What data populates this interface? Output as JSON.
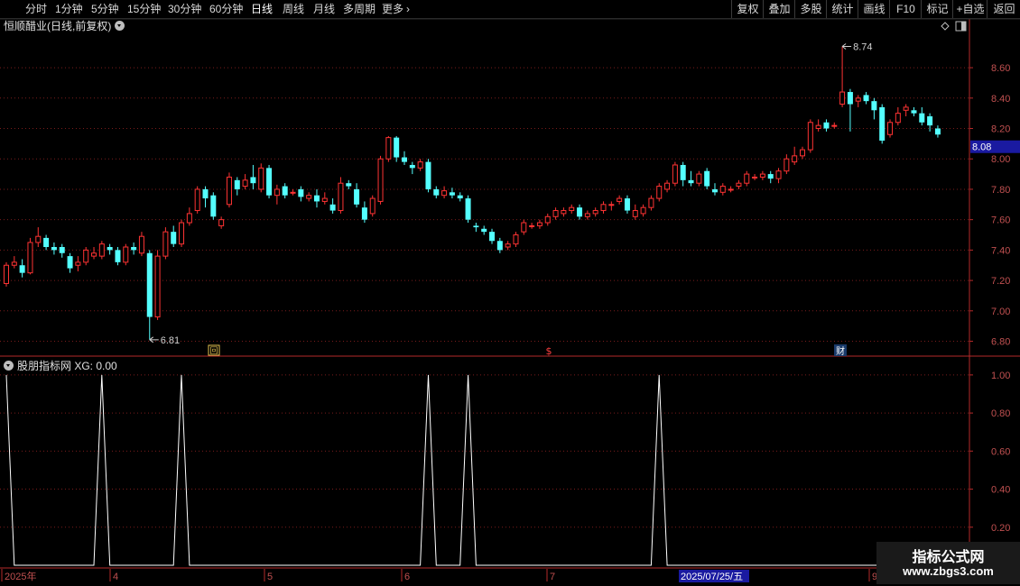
{
  "toolbar": {
    "periods": [
      "分时",
      "1分钟",
      "5分钟",
      "15分钟",
      "30分钟",
      "60分钟",
      "日线",
      "周线",
      "月线",
      "多周期",
      "更多"
    ],
    "active_period": "日线",
    "right_buttons": [
      "复权",
      "叠加",
      "多股",
      "统计",
      "画线",
      "F10",
      "标记",
      "+自选",
      "返回"
    ]
  },
  "chart_title": "恒顺醋业(日线,前复权)",
  "indicator_title": "股朋指标网 XG: 0.00",
  "price_axis": {
    "ticks": [
      "8.60",
      "8.40",
      "8.20",
      "8.00",
      "7.80",
      "7.60",
      "7.40",
      "7.20",
      "7.00",
      "6.80"
    ],
    "current_price": "8.08",
    "current_color": "#1a1aa0"
  },
  "indicator_axis": {
    "ticks": [
      "1.00",
      "0.80",
      "0.60",
      "0.40",
      "0.20"
    ]
  },
  "annotations": {
    "high": "8.74",
    "low": "6.81"
  },
  "event_markers": [
    {
      "label": "回"
    },
    {
      "label": "$"
    },
    {
      "label": "财"
    }
  ],
  "date_axis": {
    "labels": [
      "2025年",
      "4",
      "5",
      "6",
      "7",
      "9"
    ],
    "cursor_date": "2025/07/25/五"
  },
  "colors": {
    "up": "#ff3333",
    "down": "#54ffff",
    "grid": "#7a1c1c",
    "indicator_line": "#ffffff"
  },
  "watermark": {
    "line1": "指标公式网",
    "line2": "www.zbgs3.com"
  },
  "chart_data": {
    "type": "candlestick",
    "ylim": [
      6.72,
      8.82
    ],
    "candles": [
      [
        7.18,
        7.3,
        7.32,
        7.16
      ],
      [
        7.3,
        7.32,
        7.36,
        7.28
      ],
      [
        7.3,
        7.25,
        7.34,
        7.22
      ],
      [
        7.25,
        7.45,
        7.48,
        7.24
      ],
      [
        7.45,
        7.49,
        7.55,
        7.42
      ],
      [
        7.48,
        7.42,
        7.5,
        7.4
      ],
      [
        7.42,
        7.4,
        7.45,
        7.37
      ],
      [
        7.42,
        7.38,
        7.44,
        7.35
      ],
      [
        7.36,
        7.28,
        7.38,
        7.25
      ],
      [
        7.3,
        7.32,
        7.36,
        7.26
      ],
      [
        7.32,
        7.4,
        7.42,
        7.3
      ],
      [
        7.36,
        7.38,
        7.42,
        7.34
      ],
      [
        7.36,
        7.44,
        7.46,
        7.34
      ],
      [
        7.42,
        7.4,
        7.44,
        7.37
      ],
      [
        7.4,
        7.32,
        7.42,
        7.3
      ],
      [
        7.32,
        7.42,
        7.44,
        7.3
      ],
      [
        7.42,
        7.4,
        7.45,
        7.37
      ],
      [
        7.38,
        7.49,
        7.52,
        7.36
      ],
      [
        7.38,
        6.96,
        7.4,
        6.81
      ],
      [
        6.96,
        7.36,
        7.4,
        6.94
      ],
      [
        7.36,
        7.52,
        7.55,
        7.34
      ],
      [
        7.52,
        7.44,
        7.56,
        7.42
      ],
      [
        7.44,
        7.58,
        7.6,
        7.42
      ],
      [
        7.58,
        7.64,
        7.68,
        7.56
      ],
      [
        7.66,
        7.8,
        7.82,
        7.64
      ],
      [
        7.8,
        7.74,
        7.82,
        7.68
      ],
      [
        7.76,
        7.62,
        7.78,
        7.6
      ],
      [
        7.56,
        7.6,
        7.62,
        7.54
      ],
      [
        7.7,
        7.88,
        7.91,
        7.68
      ],
      [
        7.86,
        7.8,
        7.88,
        7.76
      ],
      [
        7.82,
        7.86,
        7.9,
        7.8
      ],
      [
        7.88,
        7.84,
        7.96,
        7.8
      ],
      [
        7.8,
        7.94,
        7.97,
        7.78
      ],
      [
        7.94,
        7.76,
        7.96,
        7.74
      ],
      [
        7.76,
        7.8,
        7.83,
        7.7
      ],
      [
        7.82,
        7.76,
        7.84,
        7.74
      ],
      [
        7.78,
        7.78,
        7.8,
        7.76
      ],
      [
        7.8,
        7.75,
        7.82,
        7.72
      ],
      [
        7.74,
        7.76,
        7.78,
        7.72
      ],
      [
        7.76,
        7.72,
        7.8,
        7.68
      ],
      [
        7.72,
        7.74,
        7.78,
        7.7
      ],
      [
        7.7,
        7.66,
        7.74,
        7.64
      ],
      [
        7.66,
        7.84,
        7.88,
        7.64
      ],
      [
        7.84,
        7.82,
        7.86,
        7.8
      ],
      [
        7.8,
        7.7,
        7.84,
        7.68
      ],
      [
        7.68,
        7.6,
        7.72,
        7.58
      ],
      [
        7.64,
        7.74,
        7.76,
        7.62
      ],
      [
        7.72,
        8.0,
        8.02,
        7.7
      ],
      [
        8.0,
        8.14,
        8.15,
        7.98
      ],
      [
        8.14,
        8.01,
        8.15,
        7.98
      ],
      [
        8.01,
        7.98,
        8.05,
        7.96
      ],
      [
        7.96,
        7.94,
        7.98,
        7.9
      ],
      [
        7.94,
        7.98,
        8.0,
        7.92
      ],
      [
        7.98,
        7.8,
        8.0,
        7.78
      ],
      [
        7.8,
        7.76,
        7.82,
        7.74
      ],
      [
        7.76,
        7.79,
        7.82,
        7.74
      ],
      [
        7.78,
        7.76,
        7.81,
        7.74
      ],
      [
        7.76,
        7.74,
        7.78,
        7.72
      ],
      [
        7.74,
        7.6,
        7.76,
        7.58
      ],
      [
        7.56,
        7.55,
        7.58,
        7.52
      ],
      [
        7.54,
        7.52,
        7.56,
        7.5
      ],
      [
        7.52,
        7.46,
        7.54,
        7.44
      ],
      [
        7.46,
        7.4,
        7.48,
        7.38
      ],
      [
        7.42,
        7.44,
        7.46,
        7.4
      ],
      [
        7.44,
        7.5,
        7.52,
        7.42
      ],
      [
        7.52,
        7.58,
        7.6,
        7.5
      ],
      [
        7.56,
        7.56,
        7.58,
        7.54
      ],
      [
        7.56,
        7.58,
        7.6,
        7.54
      ],
      [
        7.58,
        7.62,
        7.64,
        7.56
      ],
      [
        7.62,
        7.66,
        7.68,
        7.6
      ],
      [
        7.64,
        7.66,
        7.68,
        7.62
      ],
      [
        7.66,
        7.68,
        7.7,
        7.64
      ],
      [
        7.68,
        7.62,
        7.7,
        7.6
      ],
      [
        7.62,
        7.64,
        7.66,
        7.6
      ],
      [
        7.64,
        7.66,
        7.68,
        7.62
      ],
      [
        7.66,
        7.7,
        7.72,
        7.64
      ],
      [
        7.7,
        7.7,
        7.72,
        7.66
      ],
      [
        7.72,
        7.74,
        7.76,
        7.7
      ],
      [
        7.74,
        7.66,
        7.76,
        7.64
      ],
      [
        7.62,
        7.66,
        7.7,
        7.6
      ],
      [
        7.64,
        7.68,
        7.7,
        7.62
      ],
      [
        7.68,
        7.74,
        7.76,
        7.66
      ],
      [
        7.74,
        7.82,
        7.84,
        7.72
      ],
      [
        7.8,
        7.84,
        7.86,
        7.78
      ],
      [
        7.84,
        7.96,
        7.98,
        7.82
      ],
      [
        7.96,
        7.86,
        7.98,
        7.82
      ],
      [
        7.86,
        7.84,
        7.92,
        7.82
      ],
      [
        7.84,
        7.9,
        7.92,
        7.82
      ],
      [
        7.92,
        7.82,
        7.94,
        7.8
      ],
      [
        7.8,
        7.78,
        7.84,
        7.76
      ],
      [
        7.78,
        7.82,
        7.84,
        7.76
      ],
      [
        7.8,
        7.8,
        7.82,
        7.78
      ],
      [
        7.82,
        7.84,
        7.86,
        7.8
      ],
      [
        7.84,
        7.9,
        7.92,
        7.82
      ],
      [
        7.88,
        7.88,
        7.9,
        7.86
      ],
      [
        7.88,
        7.9,
        7.92,
        7.86
      ],
      [
        7.9,
        7.87,
        7.92,
        7.84
      ],
      [
        7.87,
        7.92,
        7.94,
        7.84
      ],
      [
        7.92,
        8.0,
        8.03,
        7.9
      ],
      [
        7.98,
        8.02,
        8.08,
        7.96
      ],
      [
        8.02,
        8.06,
        8.08,
        8.0
      ],
      [
        8.06,
        8.24,
        8.26,
        8.04
      ],
      [
        8.2,
        8.22,
        8.26,
        8.18
      ],
      [
        8.24,
        8.2,
        8.26,
        8.18
      ],
      [
        8.22,
        8.22,
        8.24,
        8.2
      ],
      [
        8.36,
        8.44,
        8.74,
        8.34
      ],
      [
        8.44,
        8.36,
        8.46,
        8.18
      ],
      [
        8.38,
        8.4,
        8.42,
        8.34
      ],
      [
        8.42,
        8.38,
        8.44,
        8.36
      ],
      [
        8.38,
        8.32,
        8.4,
        8.26
      ],
      [
        8.34,
        8.12,
        8.36,
        8.1
      ],
      [
        8.16,
        8.24,
        8.26,
        8.14
      ],
      [
        8.24,
        8.3,
        8.34,
        8.22
      ],
      [
        8.32,
        8.34,
        8.36,
        8.28
      ],
      [
        8.32,
        8.3,
        8.34,
        8.28
      ],
      [
        8.3,
        8.24,
        8.34,
        8.22
      ],
      [
        8.28,
        8.22,
        8.3,
        8.18
      ],
      [
        8.2,
        8.16,
        8.22,
        8.14
      ]
    ],
    "indicator_signals": [
      0,
      12,
      22,
      53,
      58,
      82
    ],
    "indicator_ylim": [
      0,
      1.08
    ]
  }
}
